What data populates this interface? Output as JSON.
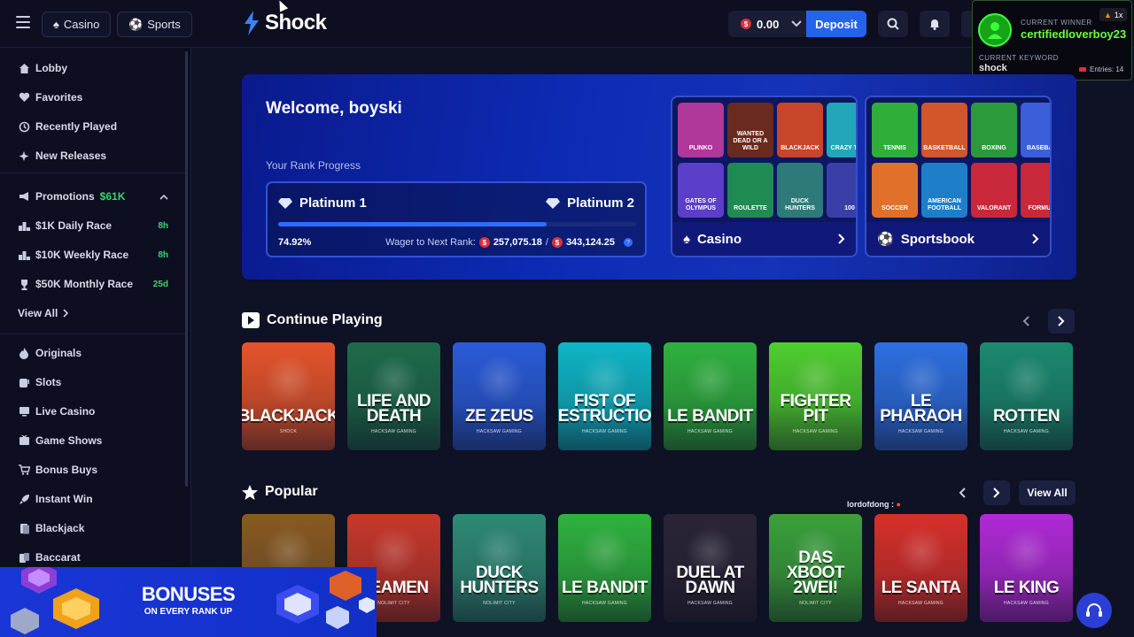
{
  "topbar": {
    "casino_label": "Casino",
    "sports_label": "Sports",
    "brand": "Shock",
    "balance": "0.00",
    "deposit_label": "Deposit"
  },
  "overlay": {
    "winner_label": "CURRENT WINNER",
    "winner_name": "certifiedloverboy23",
    "keyword_label": "CURRENT KEYWORD",
    "keyword": "shock",
    "multiplier": "1x",
    "entries": "Entries: 14"
  },
  "sidebar": {
    "items": [
      {
        "label": "Lobby",
        "icon": "home-icon"
      },
      {
        "label": "Favorites",
        "icon": "heart-icon"
      },
      {
        "label": "Recently Played",
        "icon": "history-icon"
      },
      {
        "label": "New Releases",
        "icon": "sparkle-icon"
      }
    ],
    "promotions_label": "Promotions",
    "promotions_amount": "$61K",
    "races": [
      {
        "label": "$1K Daily Race",
        "timer": "8h"
      },
      {
        "label": "$10K Weekly Race",
        "timer": "8h"
      },
      {
        "label": "$50K Monthly Race",
        "timer": "25d"
      }
    ],
    "view_all": "View All",
    "categories": [
      {
        "label": "Originals",
        "icon": "flame-icon"
      },
      {
        "label": "Slots",
        "icon": "slots-icon"
      },
      {
        "label": "Live Casino",
        "icon": "live-icon"
      },
      {
        "label": "Game Shows",
        "icon": "game-show-icon"
      },
      {
        "label": "Bonus Buys",
        "icon": "bonus-buy-icon"
      },
      {
        "label": "Instant Win",
        "icon": "rocket-icon"
      },
      {
        "label": "Blackjack",
        "icon": "cards-icon"
      },
      {
        "label": "Baccarat",
        "icon": "baccarat-icon"
      }
    ]
  },
  "hero": {
    "welcome": "Welcome, boyski",
    "rank_label": "Your Rank Progress",
    "current_rank": "Platinum 1",
    "next_rank": "Platinum 2",
    "progress_pct": "74.92%",
    "progress_value": 74.92,
    "wager_label": "Wager to Next Rank:",
    "wagered": "257,075.18",
    "wager_target": "343,124.25",
    "casino_card": {
      "label": "Casino",
      "tiles": [
        "PLINKO",
        "WANTED DEAD OR A WILD",
        "BLACKJACK",
        "CRAZY TIME",
        "GATES OF OLYMPUS",
        "ROULETTE",
        "DUCK HUNTERS",
        "100"
      ]
    },
    "sports_card": {
      "label": "Sportsbook",
      "tiles": [
        "TENNIS",
        "BASKETBALL",
        "BOXING",
        "BASEBALL",
        "SOCCER",
        "AMERICAN FOOTBALL",
        "VALORANT",
        "FORMULA"
      ]
    }
  },
  "continue_playing": {
    "title": "Continue Playing",
    "games": [
      {
        "name": "BLACKJACK",
        "provider": "SHOCK",
        "color": "#e5542a"
      },
      {
        "name": "LIFE AND DEATH",
        "provider": "HACKSAW GAMING",
        "color": "#1e6b4a"
      },
      {
        "name": "ZE ZEUS",
        "provider": "HACKSAW GAMING",
        "color": "#2a5bd8"
      },
      {
        "name": "FIST OF DESTRUCTION",
        "provider": "HACKSAW GAMING",
        "color": "#0fb6c6"
      },
      {
        "name": "LE BANDIT",
        "provider": "HACKSAW GAMING",
        "color": "#2fb23e"
      },
      {
        "name": "FIGHTER PIT",
        "provider": "HACKSAW GAMING",
        "color": "#4fcf2f"
      },
      {
        "name": "LE PHARAOH",
        "provider": "HACKSAW GAMING",
        "color": "#2d6fe0"
      },
      {
        "name": "ROTTEN",
        "provider": "HACKSAW GAMING",
        "color": "#1b8a6f"
      }
    ]
  },
  "popular": {
    "title": "Popular",
    "view_all": "View All",
    "chat_user": "lordofdong :",
    "games": [
      {
        "name": "",
        "provider": "",
        "color": "#8a5a22"
      },
      {
        "name": "SEAMEN",
        "provider": "NOLIMIT CITY",
        "color": "#c8382a"
      },
      {
        "name": "DUCK HUNTERS",
        "provider": "NOLIMIT CITY",
        "color": "#2e8a74"
      },
      {
        "name": "LE BANDIT",
        "provider": "HACKSAW GAMING",
        "color": "#2fb23e"
      },
      {
        "name": "DUEL AT DAWN",
        "provider": "HACKSAW GAMING",
        "color": "#2a2436"
      },
      {
        "name": "DAS XBOOT 2WEI!",
        "provider": "NOLIMIT CITY",
        "color": "#3aa13a"
      },
      {
        "name": "LE SANTA",
        "provider": "HACKSAW GAMING",
        "color": "#d8302a"
      },
      {
        "name": "LE KING",
        "provider": "HACKSAW GAMING",
        "color": "#b02ad6"
      }
    ]
  },
  "banner": {
    "line1": "BONUSES",
    "line2": "ON EVERY RANK UP"
  }
}
